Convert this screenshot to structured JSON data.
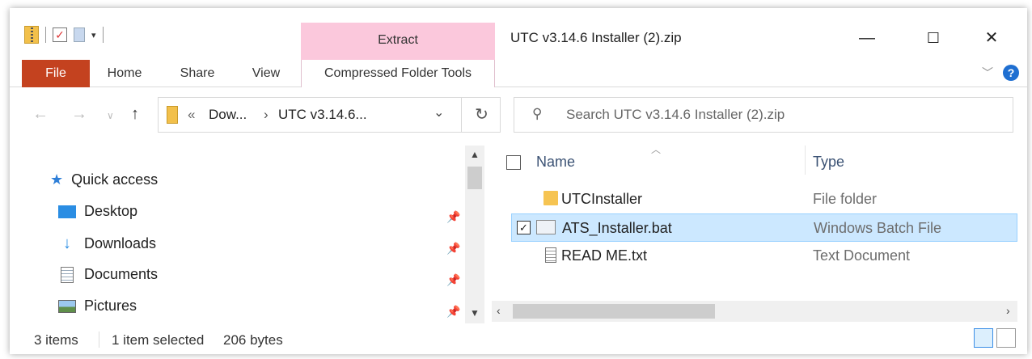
{
  "window": {
    "title": "UTC v3.14.6 Installer (2).zip",
    "contextual_tab": "Extract",
    "minimize": "—",
    "maximize": "☐",
    "close": "✕"
  },
  "ribbon": {
    "tabs": [
      "File",
      "Home",
      "Share",
      "View",
      "Compressed Folder Tools"
    ]
  },
  "address": {
    "prefix": "«",
    "crumbs": [
      "Dow...",
      "UTC v3.14.6..."
    ],
    "separator": "›"
  },
  "search": {
    "placeholder": "Search UTC v3.14.6 Installer (2).zip"
  },
  "nav_pane": {
    "quick_access": "Quick access",
    "items": [
      {
        "label": "Desktop",
        "icon": "desktop-icon"
      },
      {
        "label": "Downloads",
        "icon": "downloads-icon"
      },
      {
        "label": "Documents",
        "icon": "documents-icon"
      },
      {
        "label": "Pictures",
        "icon": "pictures-icon"
      }
    ]
  },
  "file_list": {
    "columns": [
      "Name",
      "Type"
    ],
    "rows": [
      {
        "name": "UTCInstaller",
        "type": "File folder",
        "icon": "folder-icon",
        "selected": false
      },
      {
        "name": "ATS_Installer.bat",
        "type": "Windows Batch File",
        "icon": "batch-file-icon",
        "selected": true
      },
      {
        "name": "READ ME.txt",
        "type": "Text Document",
        "icon": "text-file-icon",
        "selected": false
      }
    ]
  },
  "status": {
    "item_count": "3 items",
    "selection": "1 item selected",
    "size": "206 bytes"
  },
  "colors": {
    "file_tab": "#c4421f",
    "extract_tab": "#fbc8dc",
    "selection": "#cce8ff",
    "help": "#1f6fd1"
  }
}
